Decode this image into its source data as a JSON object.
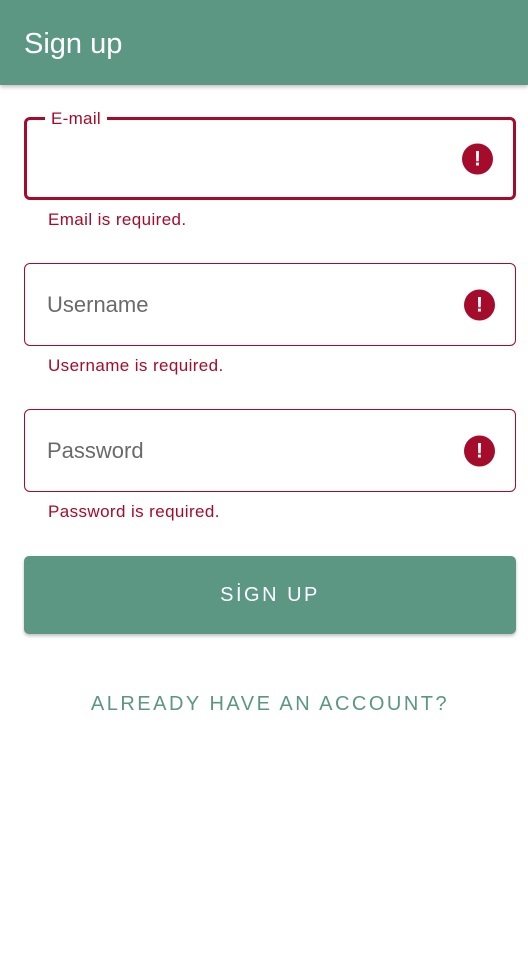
{
  "appbar": {
    "title": "Sign up"
  },
  "form": {
    "email": {
      "label": "E-mail",
      "value": "",
      "error": "Email is required.",
      "icon": "error-icon"
    },
    "username": {
      "placeholder": "Username",
      "value": "",
      "error": "Username is required.",
      "icon": "error-icon"
    },
    "password": {
      "placeholder": "Password",
      "value": "",
      "error": "Password is required.",
      "icon": "error-icon"
    },
    "error_icon_glyph": "!"
  },
  "actions": {
    "signup_label": "SİGN UP",
    "login_link_label": "ALREADY HAVE AN ACCOUNT?"
  },
  "colors": {
    "primary": "#5b9782",
    "error": "#a50b2b",
    "background": "#ffffff"
  }
}
